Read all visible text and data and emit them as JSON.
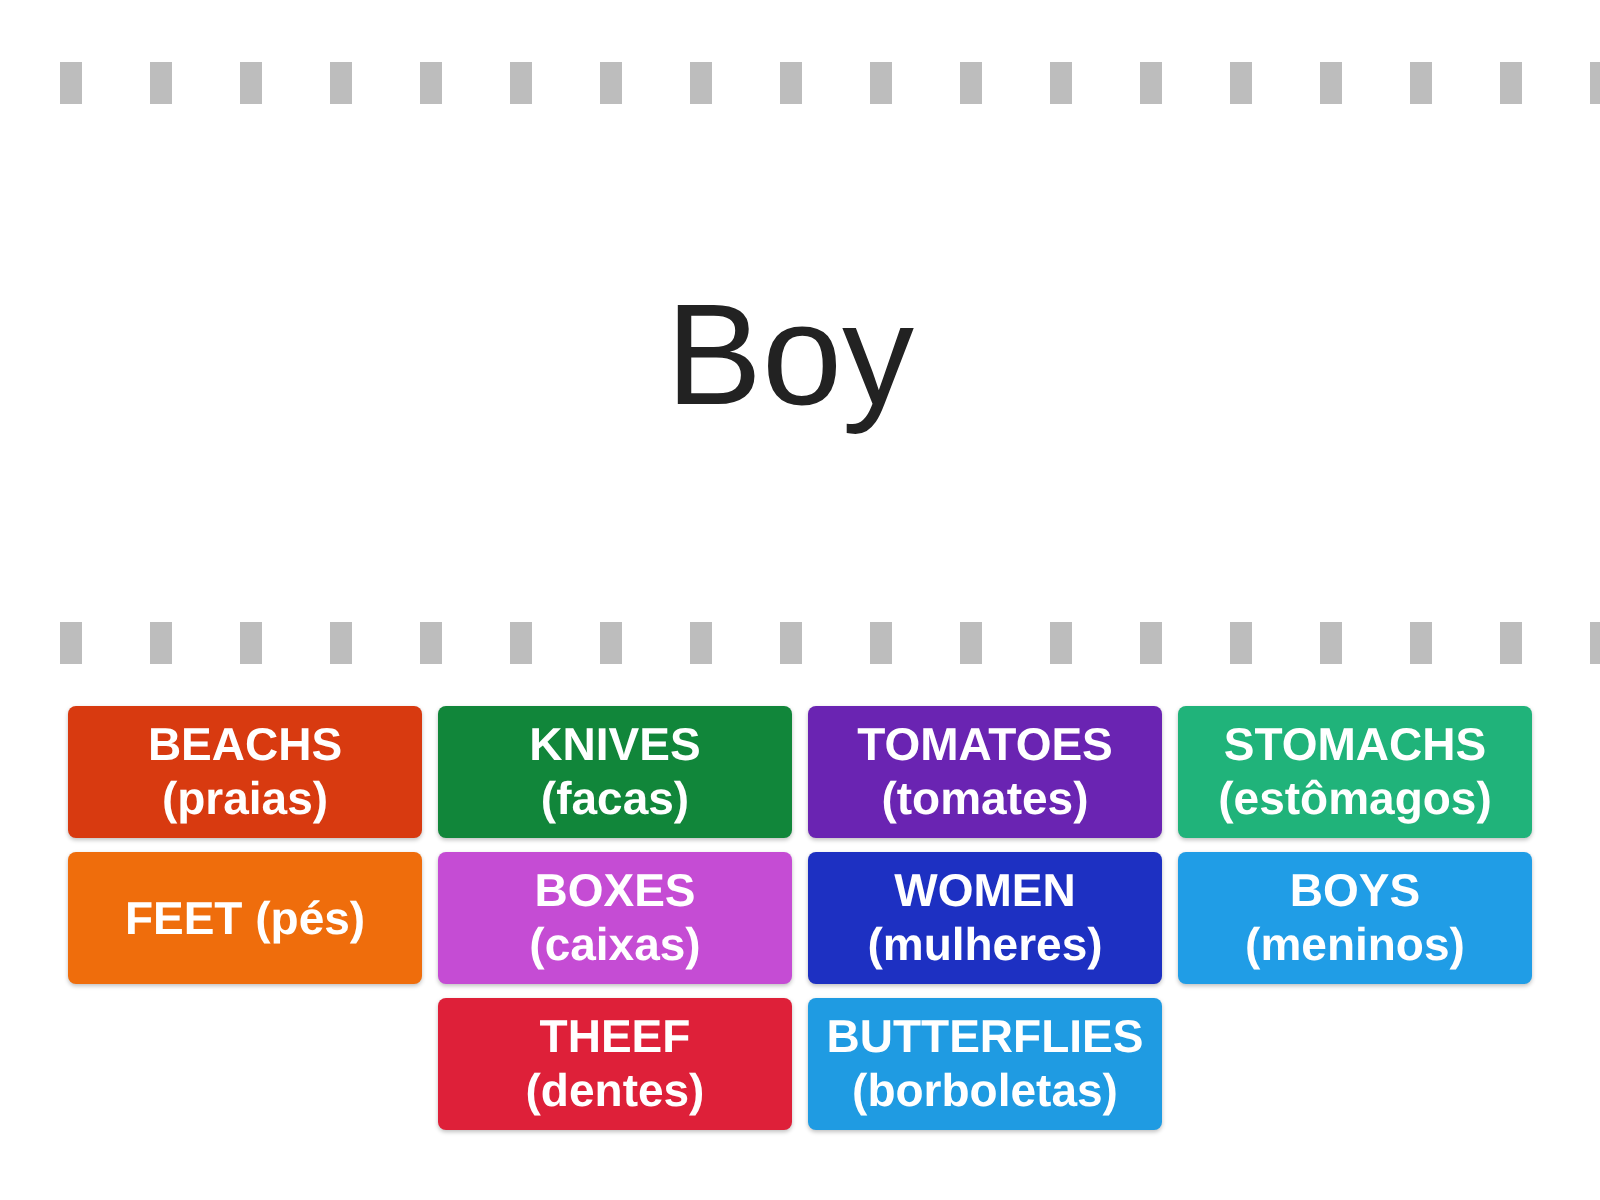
{
  "question": {
    "text": "Boy"
  },
  "answer_columns": [
    {
      "tiles": [
        {
          "text": "BEACHS\n(praias)",
          "color": "#d83a10"
        },
        {
          "text": "FEET (pés)",
          "color": "#ef6d0c"
        }
      ]
    },
    {
      "tiles": [
        {
          "text": "KNIVES\n(facas)",
          "color": "#11863a"
        },
        {
          "text": "BOXES\n(caixas)",
          "color": "#c54cd4"
        },
        {
          "text": "THEEF\n(dentes)",
          "color": "#de2039"
        }
      ]
    },
    {
      "tiles": [
        {
          "text": "TOMATOES\n(tomates)",
          "color": "#6a24b2"
        },
        {
          "text": "WOMEN\n(mulheres)",
          "color": "#1d30c2"
        },
        {
          "text": "BUTTERFLIES\n(borboletas)",
          "color": "#1f9be2"
        }
      ]
    },
    {
      "tiles": [
        {
          "text": "STOMACHS\n(estômagos)",
          "color": "#20b37a"
        },
        {
          "text": "BOYS\n(meninos)",
          "color": "#209de6"
        }
      ]
    }
  ]
}
